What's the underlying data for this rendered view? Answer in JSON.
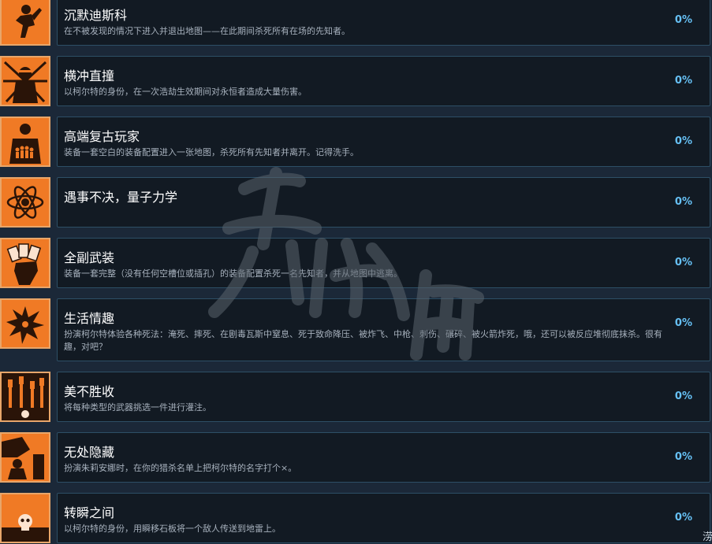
{
  "achievements": [
    {
      "title": "沉默迪斯科",
      "desc": "在不被发现的情况下进入并退出地图——在此期间杀死所有在场的先知者。",
      "percent": "0%",
      "icon": "running-man-icon"
    },
    {
      "title": "横冲直撞",
      "desc": "以柯尔特的身份，在一次浩劫生效期间对永恒者造成大量伤害。",
      "percent": "0%",
      "icon": "gunman-burst-icon"
    },
    {
      "title": "高端复古玩家",
      "desc": "装备一套空白的装备配置进入一张地图，杀死所有先知者并离开。记得洗手。",
      "percent": "0%",
      "icon": "crowd-figure-icon"
    },
    {
      "title": "遇事不决，量子力学",
      "desc": "",
      "percent": "0%",
      "icon": "atom-icon"
    },
    {
      "title": "全副武装",
      "desc": "装备一套完整（没有任何空槽位或插孔）的装备配置杀死一名先知者，并从地图中逃离。",
      "percent": "0%",
      "icon": "hand-cards-icon"
    },
    {
      "title": "生活情趣",
      "desc": "扮演柯尔特体验各种死法：淹死、摔死、在剧毒瓦斯中窒息、死于致命降压、被炸飞、中枪、刺伤、碾碎、被火箭炸死，哦，还可以被反应堆彻底抹杀。很有趣，对吧？",
      "percent": "0%",
      "icon": "explosion-icon"
    },
    {
      "title": "美不胜收",
      "desc": "将每种类型的武器挑选一件进行灌注。",
      "percent": "0%",
      "icon": "raised-fists-icon"
    },
    {
      "title": "无处隐藏",
      "desc": "扮演朱莉安娜时，在你的猎杀名单上把柯尔特的名字打个×。",
      "percent": "0%",
      "icon": "shadow-figure-icon"
    },
    {
      "title": "转瞬之间",
      "desc": "以柯尔特的身份，用瞬移石板将一个敌人传送到地雷上。",
      "percent": "0%",
      "icon": "skull-icon"
    }
  ],
  "watermark_text": "游侠网",
  "corner_glyph": "涝",
  "colors": {
    "background": "#1b2838",
    "card": "#121a23",
    "card_border": "#2d4f66",
    "icon_orange": "#f07a25",
    "percent": "#66c0f4"
  }
}
